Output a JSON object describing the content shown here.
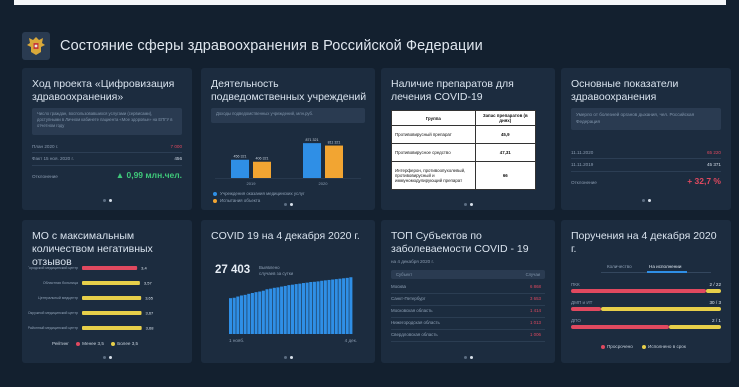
{
  "header": {
    "title": "Состояние сферы здравоохранения в Российской Федерации"
  },
  "colors": {
    "background": "#13202f",
    "card": "#1c2c3f",
    "accent_blue": "#2f8fe6",
    "accent_orange": "#f2a532",
    "red": "#e0495f",
    "yellow": "#e7cf4a",
    "green": "#3fc87a"
  },
  "cards": {
    "digital": {
      "title": "Ход проекта «Цифровизация здравоохранения»",
      "desc": "Число граждан, воспользовавшихся услугами (сервисами), доступными в Личном кабинете пациента «Мое здоровье» на ЕПГУ в отчетном году",
      "rows": [
        {
          "label": "План 2020 г.",
          "value": "7 000"
        },
        {
          "label": "Факт 15 ноя. 2020 г.",
          "value": "456"
        }
      ],
      "status_label": "Отклонение",
      "status_value": "▲ 0,99 млн.чел."
    },
    "institutions": {
      "title": "Деятельность подведомственных учреждений",
      "desc": "Доходы подведомственных учреждений, млн.руб.",
      "chart_data": {
        "type": "bar",
        "categories": [
          "2019",
          "2020"
        ],
        "series": [
          {
            "name": "Учреждения оказания медицинских услуг",
            "values": [
              456.321,
              871.321
            ]
          },
          {
            "name": "Испытания объекта",
            "values": [
              406.321,
              811.321
            ]
          }
        ],
        "value_labels": [
          [
            "456 321",
            "406 321"
          ],
          [
            "871 321",
            "811 321"
          ]
        ]
      },
      "legend": [
        "Учреждения оказания медицинских услуг",
        "Испытания объекта"
      ]
    },
    "drugs": {
      "title": "Наличие препаратов для лечения COVID-19",
      "headers": [
        "Группа",
        "Запас препаратов (в днях)"
      ],
      "rows": [
        {
          "group": "Противовирусный препарат",
          "days": "45,9"
        },
        {
          "group": "Противовирусное средство",
          "days": "47,31"
        },
        {
          "group": "Интерферон, противоопухолевый, противовирусный и иммуномодулирующий препарат",
          "days": "66"
        }
      ]
    },
    "indicators": {
      "title": "Основные показатели здравоохранения",
      "desc": "Умерло от болезней органов дыхания, чел. Российская Федерация",
      "rows": [
        {
          "label": "11.11.2020",
          "value": "65 220"
        },
        {
          "label": "11.11.2019",
          "value": "45 371"
        }
      ],
      "status_label": "Отклонение",
      "status_value": "+ 32,7 %"
    },
    "mo": {
      "title": "МО с максимальным количеством негативных отзывов",
      "chart_data": {
        "type": "bar",
        "categories": [
          "Городской медицинский центр",
          "Областная больница",
          "Центральный медцентр",
          "Окружной медицинский центр",
          "Районный медицинский центр"
        ],
        "values": [
          3.4,
          3.57,
          3.65,
          3.67,
          3.68
        ],
        "value_labels": [
          "3,4",
          "3,57",
          "3,65",
          "3,67",
          "3,68"
        ]
      },
      "legend_title": "Рейтинг",
      "legend": [
        "Менее 3,5",
        "Более 3,5"
      ]
    },
    "covid": {
      "title": "COVID 19 на 4 декабря 2020 г.",
      "big_number": "27 403",
      "big_caption": "Выявлено случаев за сутки",
      "chart_data": {
        "type": "bar",
        "x_start": "1 нояб.",
        "x_end": "4 дек.",
        "values": [
          17.3,
          17.5,
          18.1,
          18.6,
          18.9,
          19.4,
          19.8,
          20.2,
          20.5,
          20.9,
          21.6,
          21.9,
          22.3,
          22.5,
          22.9,
          23.2,
          23.6,
          23.8,
          24.1,
          24.3,
          24.6,
          24.8,
          25.1,
          25.2,
          25.4,
          25.7,
          25.9,
          26.1,
          26.3,
          26.5,
          26.7,
          26.9,
          27.1,
          27.403
        ]
      }
    },
    "subjects": {
      "title": "ТОП Субъектов по заболеваемости COVID - 19",
      "date": "на 4 декабря 2020 г.",
      "headers": [
        "Субъект",
        "Случаи"
      ],
      "rows": [
        {
          "name": "Москва",
          "value": "6 868"
        },
        {
          "name": "Санкт-Петербург",
          "value": "3 653"
        },
        {
          "name": "Московская область",
          "value": "1 414"
        },
        {
          "name": "Нижегородская область",
          "value": "1 013"
        },
        {
          "name": "Свердловская область",
          "value": "1 006"
        }
      ]
    },
    "orders": {
      "title": "Поручения на 4 декабря 2020 г.",
      "tabs": [
        "Количество",
        "На исполнении"
      ],
      "active_tab": 1,
      "rows": [
        {
          "label": "ПКК",
          "value": "2 / 22",
          "red": 0.9,
          "yellow": 0.1
        },
        {
          "label": "ДМП и ИТ",
          "value": "30 / 3",
          "red": 0.2,
          "yellow": 0.8
        },
        {
          "label": "ДПО",
          "value": "2 / 1",
          "red": 0.65,
          "yellow": 0.35
        }
      ],
      "legend": [
        "Просрочено",
        "Исполнено в срок"
      ]
    }
  }
}
